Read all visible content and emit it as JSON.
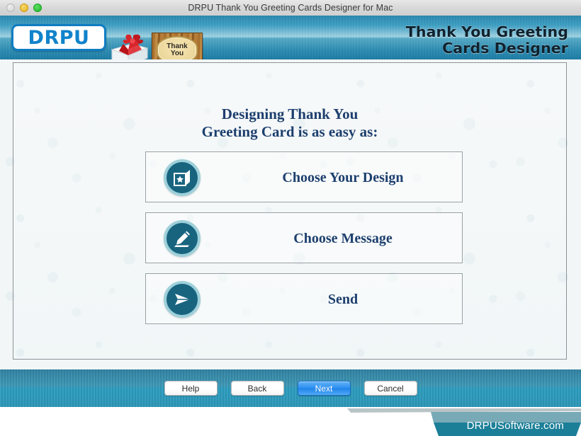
{
  "window": {
    "title": "DRPU Thank You Greeting Cards Designer for Mac",
    "traffic_lights": [
      {
        "name": "close-button",
        "color": "#d2d2d2"
      },
      {
        "name": "minimize-button",
        "color": "#e8b11c"
      },
      {
        "name": "zoom-button",
        "color": "#23b92c"
      }
    ]
  },
  "banner": {
    "logo_text": "DRPU",
    "card_art_label_line1": "Thank",
    "card_art_label_line2": "You",
    "title_line1": "Thank You Greeting",
    "title_line2": "Cards Designer",
    "accent_color": "#2a87ae"
  },
  "main": {
    "headline_line1": "Designing Thank You",
    "headline_line2": "Greeting Card is as easy as:",
    "headline_color": "#1d3f6e",
    "options": [
      {
        "icon": "greeting-card-star-icon",
        "label": "Choose Your Design"
      },
      {
        "icon": "pen-nib-icon",
        "label": "Choose Message"
      },
      {
        "icon": "send-paper-plane-icon",
        "label": "Send"
      }
    ]
  },
  "actions": {
    "help_label": "Help",
    "back_label": "Back",
    "next_label": "Next",
    "cancel_label": "Cancel",
    "primary_color": "#2e90f0"
  },
  "footer": {
    "site": "DRPUSoftware.com",
    "ribbon_color": "#1b7f98"
  }
}
